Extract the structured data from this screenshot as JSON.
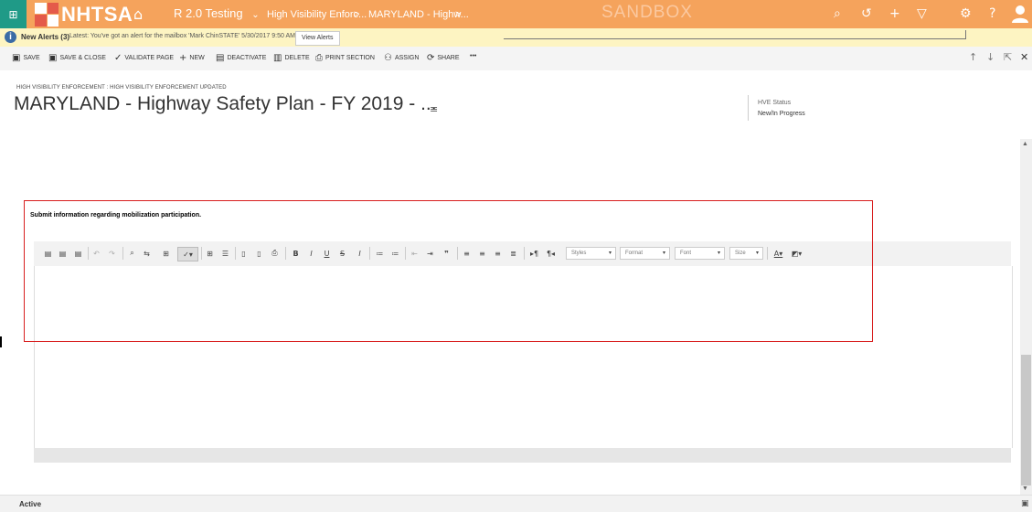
{
  "topnav": {
    "logo_text": "NHTSA",
    "app_name": "R 2.0 Testing",
    "app_chevron": "⌄",
    "crumb1": "High Visibility Enforc...",
    "crumb2": "MARYLAND - Highw...",
    "sep": ">",
    "environment": "SANDBOX",
    "icons": [
      "search-icon",
      "history-icon",
      "add-icon",
      "filter-icon",
      "settings-icon",
      "help-icon",
      "user-icon"
    ]
  },
  "alert": {
    "title": "New Alerts (3)",
    "message": "Latest: You've got an alert for the mailbox 'Mark ChinSTATE' 5/30/2017 9:50 AM",
    "view_label": "View Alerts"
  },
  "commands": {
    "save": "SAVE",
    "save_close": "SAVE & CLOSE",
    "validate": "VALIDATE PAGE",
    "new": "NEW",
    "deactivate": "DEACTIVATE",
    "delete": "DELETE",
    "print": "PRINT SECTION",
    "assign": "ASSIGN",
    "share": "SHARE",
    "more": "•••"
  },
  "header": {
    "breadcrumb": "HIGH VISIBILITY ENFORCEMENT : HIGH VISIBILITY ENFORCEMENT UPDATED",
    "title": "MARYLAND - Highway Safety Plan - FY 2019 - ...",
    "status_label": "HVE Status",
    "status_value": "New/In Progress"
  },
  "section": {
    "heading": "Submit information regarding mobilization participation."
  },
  "editor": {
    "styles": "Styles",
    "format": "Format",
    "font": "Font",
    "size": "Size"
  },
  "footer": {
    "status": "Active"
  },
  "colors": {
    "nav_orange": "#f5a35c",
    "waffle_teal": "#1f9a87",
    "alert_yellow": "#fdf4c2",
    "highlight_red": "#d81e1e"
  }
}
